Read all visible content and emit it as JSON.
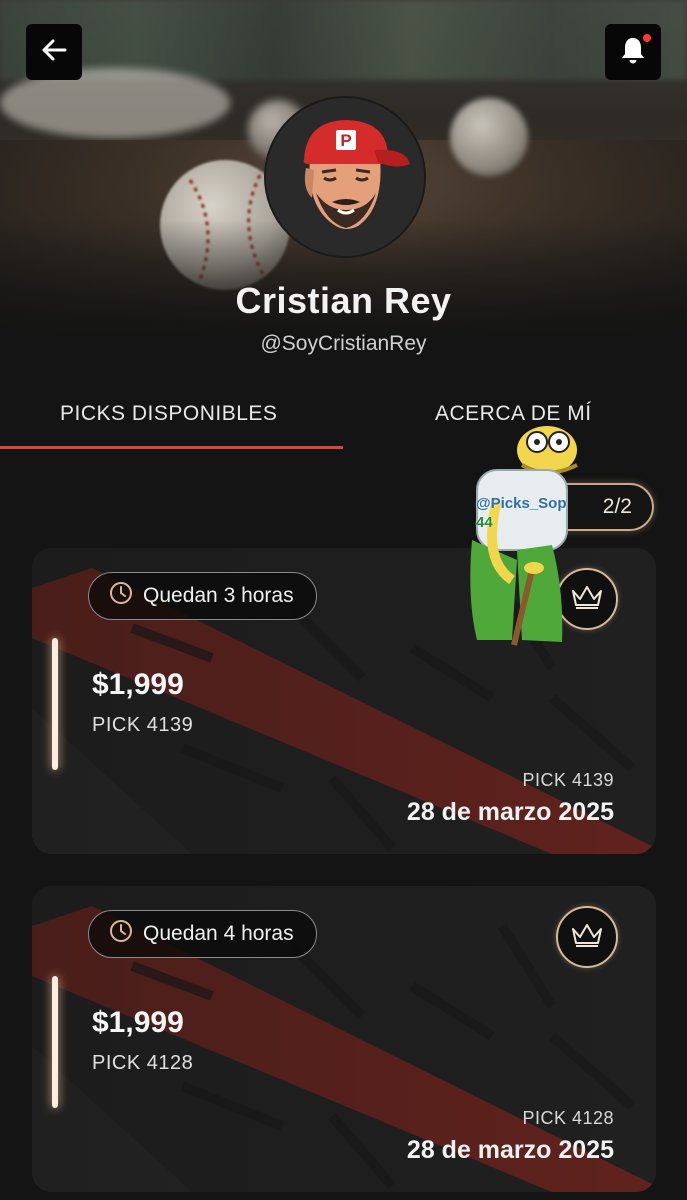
{
  "header": {
    "back_icon": "arrow-left-icon",
    "bell_icon": "bell-icon",
    "has_notification": true
  },
  "profile": {
    "name": "Cristian Rey",
    "handle": "@SoyCristianRey",
    "avatar_cap_letter": "P"
  },
  "tabs": [
    {
      "label": "PICKS DISPONIBLES",
      "active": true
    },
    {
      "label": "ACERCA DE MÍ",
      "active": false
    }
  ],
  "counter": {
    "icon": "crown-icon",
    "value": "2/2"
  },
  "sticker": {
    "line1": "@Picks_Sop",
    "line2": "44"
  },
  "picks": [
    {
      "timer": "Quedan 3 horas",
      "price": "$1,999",
      "pick_label": "PICK 4139",
      "pick_label_right": "PICK 4139",
      "date": "28 de marzo 2025"
    },
    {
      "timer": "Quedan 4 horas",
      "price": "$1,999",
      "pick_label": "PICK 4128",
      "pick_label_right": "PICK 4128",
      "date": "28 de marzo 2025"
    }
  ],
  "colors": {
    "background": "#141414",
    "accent_red": "#e0433a",
    "gold": "#d8b99a"
  }
}
